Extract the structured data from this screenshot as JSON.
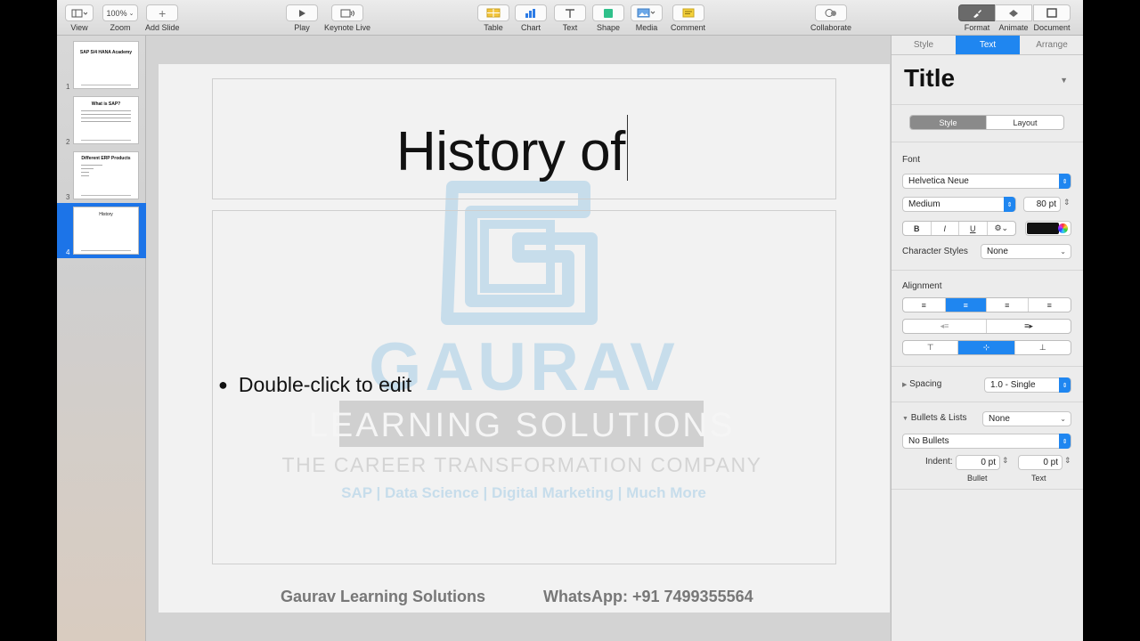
{
  "toolbar": {
    "view": "View",
    "zoom_value": "100%",
    "zoom": "Zoom",
    "add_slide": "Add Slide",
    "play": "Play",
    "keynote_live": "Keynote Live",
    "table": "Table",
    "chart": "Chart",
    "text": "Text",
    "shape": "Shape",
    "media": "Media",
    "comment": "Comment",
    "collaborate": "Collaborate",
    "format": "Format",
    "animate": "Animate",
    "document": "Document"
  },
  "navigator": {
    "slides": [
      {
        "num": "1",
        "title": "SAP S/4 HANA Academy"
      },
      {
        "num": "2",
        "title": "What is SAP?"
      },
      {
        "num": "3",
        "title": "Different ERP Products"
      },
      {
        "num": "4",
        "title": "History"
      }
    ]
  },
  "slide": {
    "title": "History of",
    "bullet": "Double-click to edit",
    "footer_left": "Gaurav Learning Solutions",
    "footer_right": "WhatsApp: +91 7499355564",
    "watermark": {
      "name": "GAURAV",
      "band": "LEARNING SOLUTIONS",
      "tagline": "THE CAREER TRANSFORMATION COMPANY",
      "services": "SAP | Data Science | Digital Marketing | Much More"
    }
  },
  "inspector": {
    "tabs": [
      "Style",
      "Text",
      "Arrange"
    ],
    "active_tab": "Text",
    "style_name": "Title",
    "sub_tabs": [
      "Style",
      "Layout"
    ],
    "font_label": "Font",
    "font_family": "Helvetica Neue",
    "font_weight": "Medium",
    "font_size": "80 pt",
    "bold": "B",
    "italic": "I",
    "underline": "U",
    "character_styles_label": "Character Styles",
    "character_styles_value": "None",
    "alignment_label": "Alignment",
    "spacing_label": "Spacing",
    "spacing_value": "1.0 - Single",
    "bullets_label": "Bullets & Lists",
    "bullets_value": "None",
    "bullet_style": "No Bullets",
    "indent_label": "Indent:",
    "indent_bullet": "0 pt",
    "indent_text": "0 pt",
    "bullet_caption": "Bullet",
    "text_caption": "Text",
    "colors": {
      "accent": "#1f86f0",
      "text_color": "#111111"
    }
  }
}
